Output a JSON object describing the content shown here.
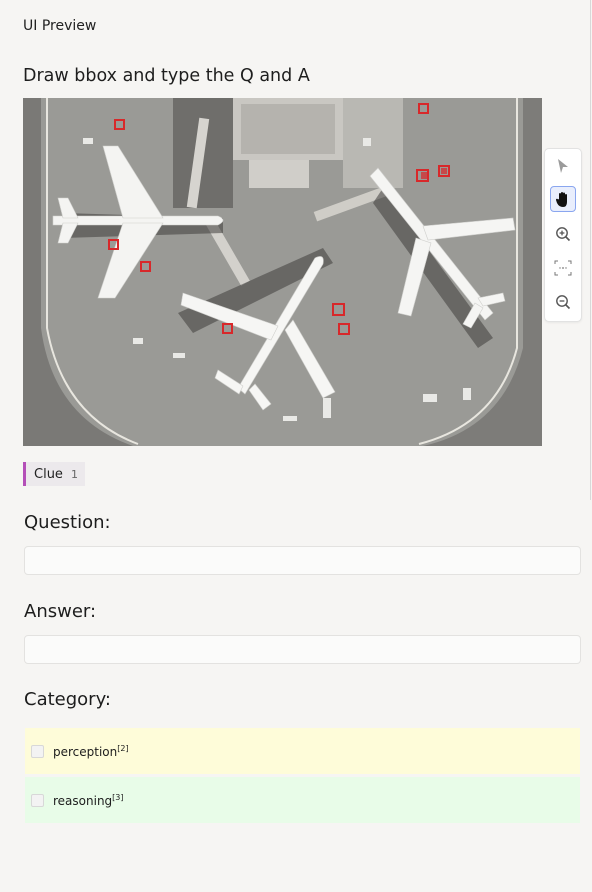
{
  "header": {
    "title": "UI Preview"
  },
  "task": {
    "heading": "Draw bbox and type the Q and A"
  },
  "toolbar": {
    "tools": [
      {
        "name": "pointer",
        "active": false
      },
      {
        "name": "hand",
        "active": true
      },
      {
        "name": "zoom-in",
        "active": false
      },
      {
        "name": "fit-to-screen",
        "active": false
      },
      {
        "name": "zoom-out",
        "active": false
      }
    ]
  },
  "clue": {
    "label": "Clue",
    "count": "1",
    "color": "#b44fb8"
  },
  "question": {
    "label": "Question:",
    "value": "",
    "placeholder": ""
  },
  "answer": {
    "label": "Answer:",
    "value": "",
    "placeholder": ""
  },
  "category": {
    "label": "Category:",
    "options": [
      {
        "label": "perception",
        "hotkey": "[2]",
        "color": "#fefcd9",
        "checked": false
      },
      {
        "label": "reasoning",
        "hotkey": "[3]",
        "color": "#e8fce8",
        "checked": false
      }
    ]
  }
}
